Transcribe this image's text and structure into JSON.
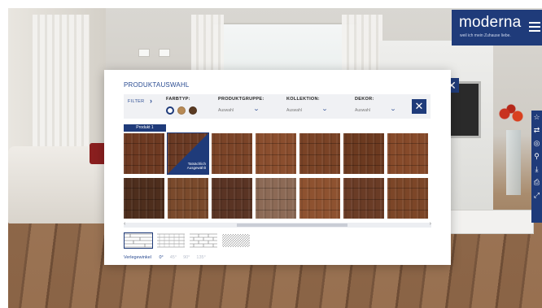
{
  "brand": {
    "name": "moderna",
    "tagline": "weil ich mein Zuhause liebe.",
    "menu_icon": "hamburger-icon",
    "color": "#1f3b7a"
  },
  "sidebar": {
    "tools": [
      {
        "icon": "star-icon",
        "glyph": "☆"
      },
      {
        "icon": "split-view-icon",
        "glyph": "⇄"
      },
      {
        "icon": "target-icon",
        "glyph": "◎"
      },
      {
        "icon": "link-icon",
        "glyph": "⚲"
      },
      {
        "icon": "download-icon",
        "glyph": "⤓"
      },
      {
        "icon": "print-icon",
        "glyph": "⎙"
      },
      {
        "icon": "fullscreen-icon",
        "glyph": "⤢"
      }
    ]
  },
  "modal": {
    "title": "PRODUKTAUSWAHL",
    "close_glyph": "✕",
    "filter": {
      "label": "FILTER",
      "arrow": "›",
      "farbtyp_label": "FARBTYP:",
      "swatches": [
        "#ffffff",
        "#b88a55",
        "#5a3a22"
      ],
      "produktgruppe_label": "PRODUKTGRUPPE:",
      "produktgruppe_value": "Auswahl",
      "kollektion_label": "KOLLEKTION:",
      "kollektion_value": "Auswahl",
      "dekor_label": "DEKOR:",
      "dekor_value": "Auswahl",
      "clear_glyph": "✕"
    },
    "product_tab": "Produkt 1",
    "tiles": [
      {
        "color": "#6e3a22",
        "selected": false
      },
      {
        "color": "#6a3a24",
        "selected": true,
        "badge_line1": "Tatsächlich",
        "badge_line2": "Ausgewählt"
      },
      {
        "color": "#7b4428",
        "selected": false
      },
      {
        "color": "#8a4e2e",
        "selected": false
      },
      {
        "color": "#7a4326",
        "selected": false
      },
      {
        "color": "#6c3a20",
        "selected": false
      },
      {
        "color": "#864a2a",
        "selected": false
      },
      {
        "color": "#4e2e1d",
        "selected": false
      },
      {
        "color": "#7a4a2c",
        "selected": false
      },
      {
        "color": "#5a3424",
        "selected": false
      },
      {
        "color": "#8c6a56",
        "selected": false
      },
      {
        "color": "#8e5230",
        "selected": false
      },
      {
        "color": "#6a3c26",
        "selected": false
      },
      {
        "color": "#7c4628",
        "selected": false
      }
    ],
    "scroll": {
      "left_glyph": "‹",
      "right_glyph": "›",
      "position": 0.58,
      "visible_fraction": 0.38
    },
    "patterns": [
      {
        "icon": "plank-pattern-icon",
        "selected": true
      },
      {
        "icon": "herringbone-pattern-icon",
        "selected": false
      },
      {
        "icon": "brick-pattern-icon",
        "selected": false
      },
      {
        "icon": "chevron-pattern-icon",
        "selected": false
      }
    ],
    "angle_label": "Verlegewinkel",
    "angles": [
      "0°",
      "45°",
      "90°",
      "135°"
    ],
    "angle_selected": 0
  }
}
